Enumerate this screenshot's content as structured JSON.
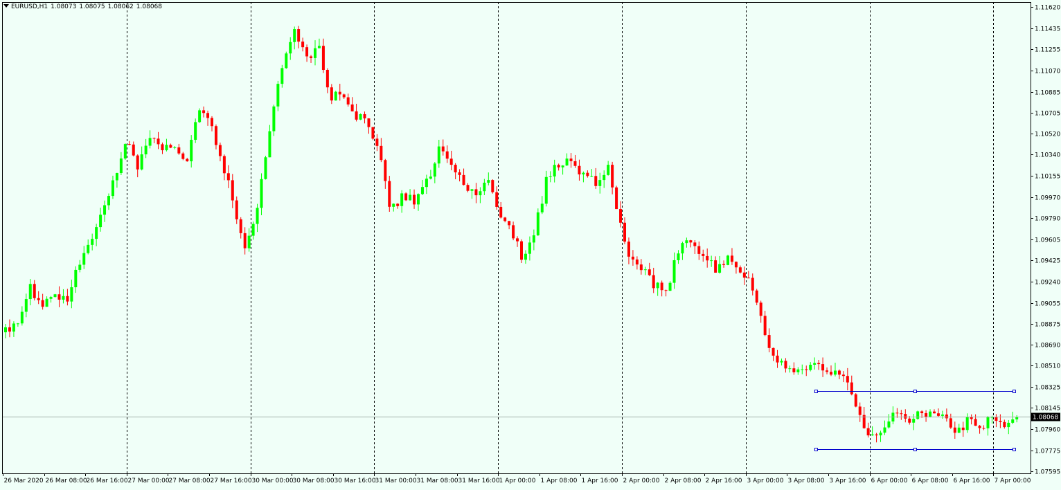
{
  "header": {
    "symbol_tf": "EURUSD,H1",
    "open": "1.08073",
    "high": "1.08075",
    "low": "1.08062",
    "close": "1.08068"
  },
  "colors": {
    "background": "#f0fff8",
    "bull": "#00ff00",
    "bear": "#ff0000",
    "grid": "#000000",
    "last_price_line": "#a0b0a8",
    "channel": "#0000cc",
    "price_tag_bg": "#000000",
    "price_tag_text": "#ffffff"
  },
  "chart_data": {
    "type": "candlestick",
    "symbol": "EURUSD",
    "timeframe": "H1",
    "ylim": [
      1.07595,
      1.1162
    ],
    "y_ticks": [
      "1.11620",
      "1.11435",
      "1.11255",
      "1.11070",
      "1.10885",
      "1.10705",
      "1.10520",
      "1.10340",
      "1.10155",
      "1.09970",
      "1.09790",
      "1.09605",
      "1.09425",
      "1.09240",
      "1.09055",
      "1.08875",
      "1.08690",
      "1.08510",
      "1.08325",
      "1.08145",
      "1.07960",
      "1.07775",
      "1.07595"
    ],
    "x_labels": [
      "26 Mar 2020",
      "26 Mar 08:00",
      "26 Mar 16:00",
      "27 Mar 00:00",
      "27 Mar 08:00",
      "27 Mar 16:00",
      "30 Mar 00:00",
      "30 Mar 08:00",
      "30 Mar 16:00",
      "31 Mar 00:00",
      "31 Mar 08:00",
      "31 Mar 16:00",
      "1 Apr 00:00",
      "1 Apr 08:00",
      "1 Apr 16:00",
      "2 Apr 00:00",
      "2 Apr 08:00",
      "2 Apr 16:00",
      "3 Apr 00:00",
      "3 Apr 08:00",
      "3 Apr 16:00",
      "6 Apr 00:00",
      "6 Apr 08:00",
      "6 Apr 16:00",
      "7 Apr 00:00"
    ],
    "day_separators": [
      "27 Mar 00:00",
      "30 Mar 00:00",
      "31 Mar 00:00",
      "1 Apr 00:00",
      "2 Apr 00:00",
      "3 Apr 00:00",
      "6 Apr 00:00",
      "7 Apr 00:00"
    ],
    "last_price": 1.08068,
    "last_price_label": "1.08068",
    "grid": false,
    "anchors": [
      1.088,
      1.089,
      1.092,
      1.0905,
      1.0918,
      1.0905,
      1.0935,
      1.096,
      1.0985,
      1.101,
      1.1045,
      1.1025,
      1.105,
      1.1035,
      1.1045,
      1.102,
      1.1075,
      1.106,
      1.1028,
      1.099,
      1.095,
      1.0995,
      1.106,
      1.1115,
      1.114,
      1.1115,
      1.113,
      1.108,
      1.109,
      1.107,
      1.106,
      1.104,
      1.0985,
      1.1,
      1.0995,
      1.101,
      1.1038,
      1.103,
      1.1005,
      1.1,
      1.1012,
      1.0985,
      1.097,
      1.094,
      1.097,
      1.1015,
      1.1025,
      1.1028,
      1.1015,
      1.101,
      1.1025,
      1.0975,
      1.094,
      1.0935,
      1.092,
      1.0918,
      1.0955,
      1.0958,
      1.0945,
      1.0935,
      1.0945,
      1.093,
      1.092,
      1.088,
      1.0858,
      1.0848,
      1.0845,
      1.0853,
      1.085,
      1.0845,
      1.0835,
      1.0805,
      1.0788,
      1.08,
      1.081,
      1.0805,
      1.0808,
      1.0812,
      1.081,
      1.079,
      1.0808,
      1.0795,
      1.081,
      1.0795,
      1.0807
    ],
    "drawn_objects": [
      {
        "type": "horizontal_segment",
        "from": "3 Apr 08:00",
        "to": "7 Apr 00:00",
        "price": 1.0829
      },
      {
        "type": "horizontal_segment",
        "from": "3 Apr 08:00",
        "to": "7 Apr 00:00",
        "price": 1.07785
      }
    ]
  }
}
